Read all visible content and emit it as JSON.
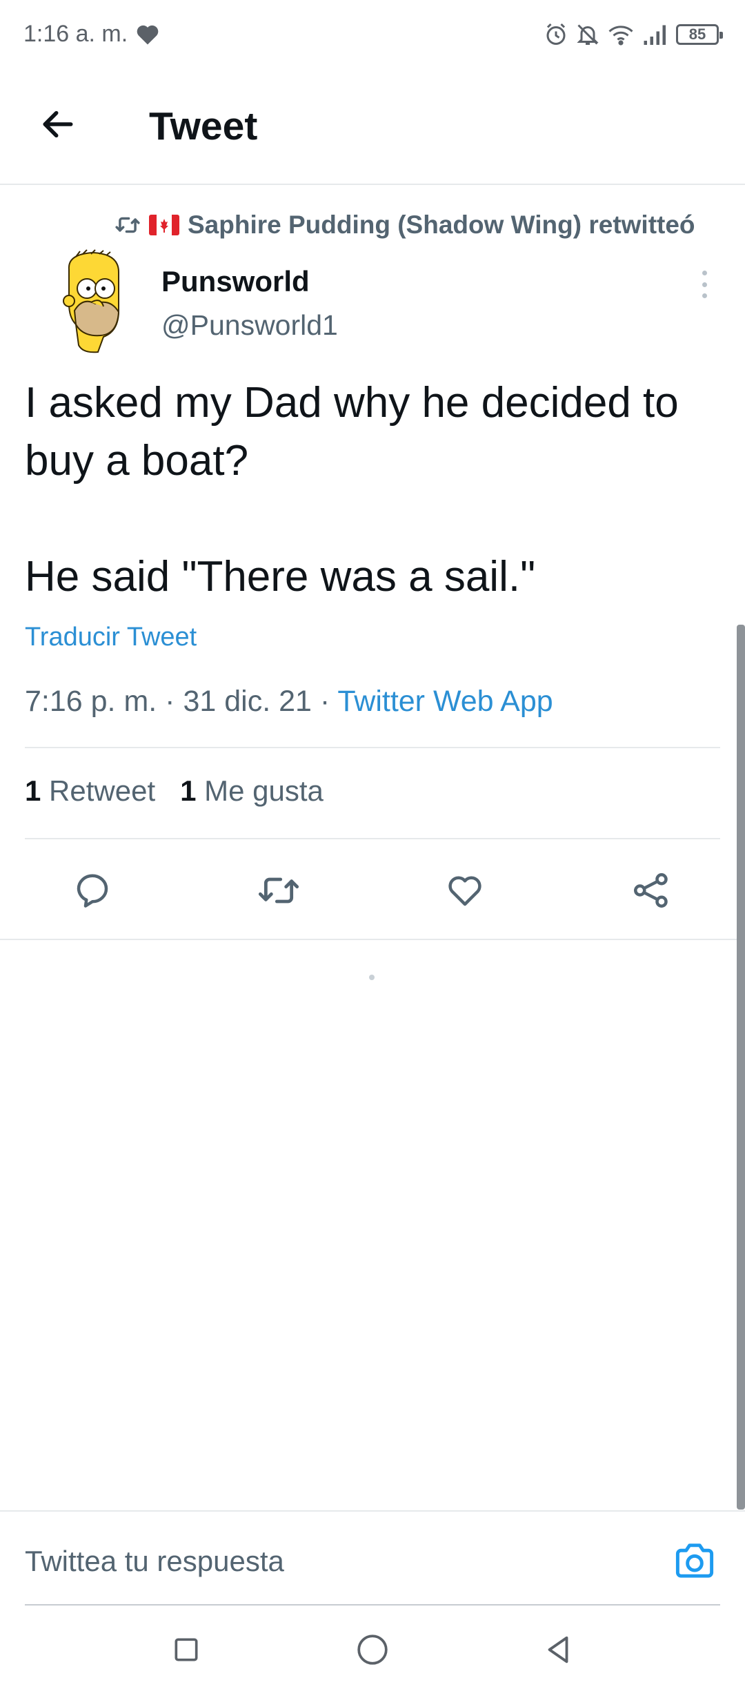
{
  "status_bar": {
    "time": "1:16 a. m.",
    "battery": "85",
    "icons": [
      "heart-icon",
      "alarm-icon",
      "bell-off-icon",
      "wifi-icon",
      "signal-icon"
    ],
    "color": "#5b6168"
  },
  "header": {
    "title": "Tweet",
    "back_icon": "arrow-left-icon"
  },
  "retweet": {
    "icon": "retweet-icon",
    "flag_icon": "canada-flag-icon",
    "text": "Saphire Pudding (Shadow Wing) retwitteó"
  },
  "tweet": {
    "author_name": "Punsworld",
    "author_handle": "@Punsworld1",
    "text": "I asked my Dad why he decided to buy a boat?\n\nHe said \"There was a sail.\"",
    "translate_label": "Traducir Tweet",
    "time": "7:16 p. m.",
    "date": "31 dic. 21",
    "separator": "·",
    "source": "Twitter Web App",
    "retweet_count": "1",
    "retweet_label": "Retweet",
    "like_count": "1",
    "like_label": "Me gusta"
  },
  "actions": [
    "reply-icon",
    "retweet-icon",
    "like-icon",
    "share-icon"
  ],
  "reply_bar": {
    "placeholder": "Twittea tu respuesta",
    "camera_icon": "camera-icon"
  },
  "nav": [
    "recents-square-icon",
    "home-circle-icon",
    "back-triangle-icon"
  ],
  "colors": {
    "accent": "#1d9bf0",
    "link": "#2b8fd4",
    "secondary_text": "#536471",
    "primary_text": "#0f1419"
  }
}
